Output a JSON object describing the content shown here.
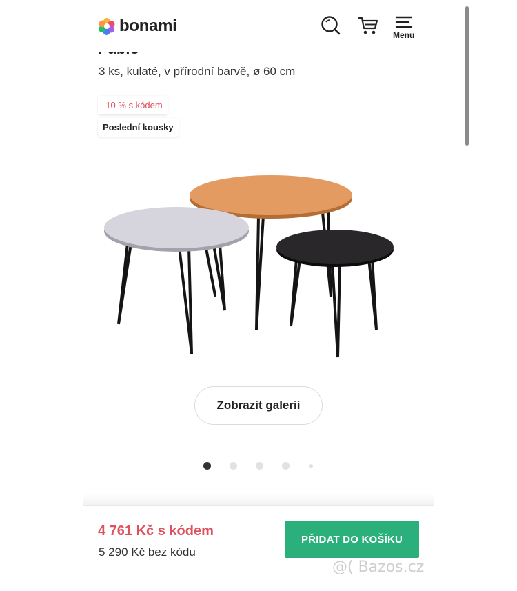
{
  "header": {
    "logo_text": "bonami",
    "menu_label": "Menu"
  },
  "product": {
    "title_cut": "Pablo",
    "subtitle": "3 ks, kulaté, v přírodní barvě, ø 60 cm",
    "badges": {
      "discount": "-10 % s kódem",
      "last_pieces": "Poslední kousky"
    },
    "gallery_button": "Zobrazit galerii",
    "gallery": {
      "total_dots": 5,
      "active_index": 0
    }
  },
  "price": {
    "with_code": "4 761 Kč s kódem",
    "without_code": "5 290 Kč bez kódu"
  },
  "actions": {
    "add_to_cart": "PŘIDAT DO KOŠÍKU"
  },
  "watermark": "@( Bazos.cz",
  "colors": {
    "accent_green": "#2bb07b",
    "discount_red": "#e0515e",
    "text": "#222222"
  },
  "icons": [
    "bonami-logo-icon",
    "search-icon",
    "cart-icon",
    "menu-icon"
  ]
}
